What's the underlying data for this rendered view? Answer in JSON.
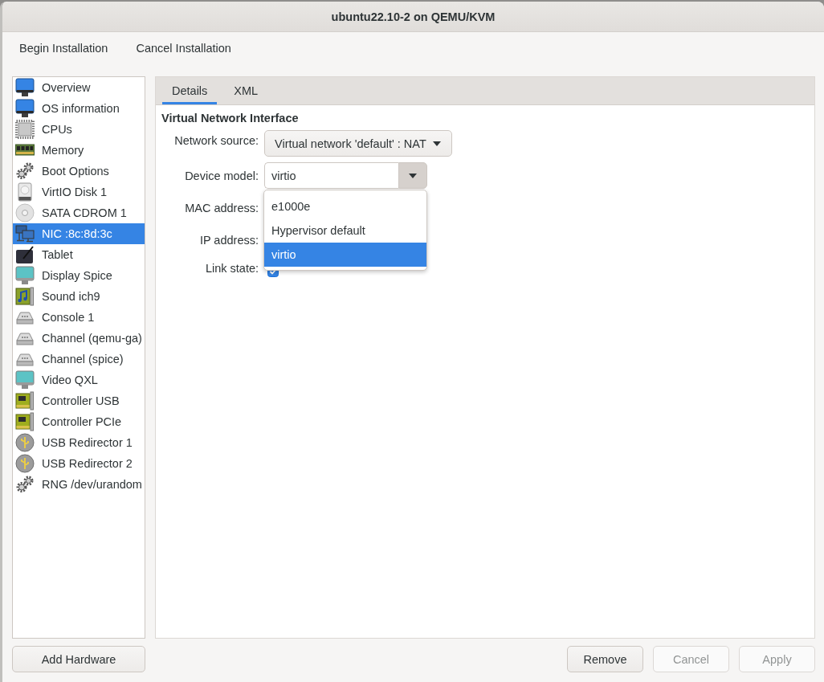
{
  "window": {
    "title": "ubuntu22.10-2 on QEMU/KVM"
  },
  "toolbar": [
    {
      "label": "Begin Installation"
    },
    {
      "label": "Cancel Installation"
    }
  ],
  "sidebar": {
    "items": [
      {
        "label": "Overview",
        "selected": false
      },
      {
        "label": "OS information",
        "selected": false
      },
      {
        "label": "CPUs",
        "selected": false
      },
      {
        "label": "Memory",
        "selected": false
      },
      {
        "label": "Boot Options",
        "selected": false
      },
      {
        "label": "VirtIO Disk 1",
        "selected": false
      },
      {
        "label": "SATA CDROM 1",
        "selected": false
      },
      {
        "label": "NIC :8c:8d:3c",
        "selected": true
      },
      {
        "label": "Tablet",
        "selected": false
      },
      {
        "label": "Display Spice",
        "selected": false
      },
      {
        "label": "Sound ich9",
        "selected": false
      },
      {
        "label": "Console 1",
        "selected": false
      },
      {
        "label": "Channel (qemu-ga)",
        "selected": false
      },
      {
        "label": "Channel (spice)",
        "selected": false
      },
      {
        "label": "Video QXL",
        "selected": false
      },
      {
        "label": "Controller USB",
        "selected": false
      },
      {
        "label": "Controller PCIe",
        "selected": false
      },
      {
        "label": "USB Redirector 1",
        "selected": false
      },
      {
        "label": "USB Redirector 2",
        "selected": false
      },
      {
        "label": "RNG /dev/urandom",
        "selected": false
      }
    ]
  },
  "tabs": [
    {
      "label": "Details",
      "selected": true
    },
    {
      "label": "XML",
      "selected": false
    }
  ],
  "section_title": "Virtual Network Interface",
  "form": {
    "network_source": {
      "label": "Network source:",
      "value": "Virtual network 'default' : NAT"
    },
    "device_model": {
      "label": "Device model:",
      "value": "virtio",
      "expanded": true,
      "options": [
        {
          "label": "e1000e",
          "selected": false
        },
        {
          "label": "Hypervisor default",
          "selected": false
        },
        {
          "label": "virtio",
          "selected": true
        }
      ]
    },
    "mac_address": {
      "label": "MAC address:"
    },
    "ip_address": {
      "label": "IP address:"
    },
    "link_state": {
      "label": "Link state:",
      "checked": true
    }
  },
  "buttons": {
    "add_hardware": {
      "label": "Add Hardware",
      "disabled": false
    },
    "actions": [
      {
        "label": "Remove",
        "disabled": false
      },
      {
        "label": "Cancel",
        "disabled": true
      },
      {
        "label": "Apply",
        "disabled": true
      }
    ]
  }
}
